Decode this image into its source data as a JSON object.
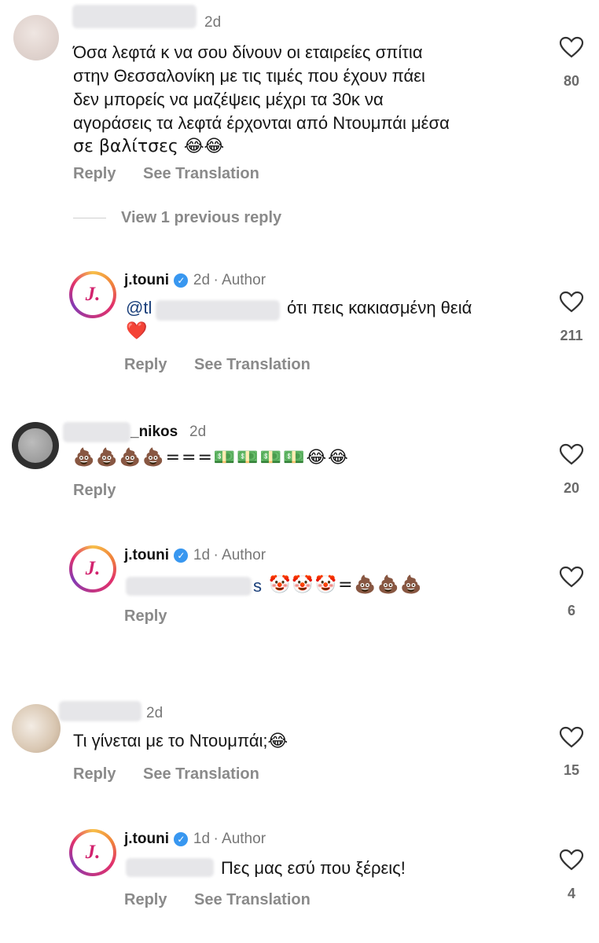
{
  "comments": [
    {
      "time": "2d",
      "text_lines": [
        "Όσα λεφτά κ να σου δίνουν οι εταιρείες σπίτια",
        "στην Θεσσαλονίκη με τις τιμές που έχουν πάει",
        "δεν μπορείς να μαζέψεις μέχρι τα 30κ να",
        "αγοράσεις τα λεφτά έρχονται από Ντουμπάι μέσα",
        "σε βαλίτσες 😂😂"
      ],
      "likes": "80",
      "reply": "Reply",
      "translate": "See Translation"
    },
    {
      "view_replies": "View 1 previous reply"
    },
    {
      "user": "j.touni",
      "time": "2d",
      "author": "· Author",
      "mention_prefix": "@tl",
      "text": "ότι πεις κακιασμένη θειά",
      "text2": "❤️",
      "likes": "211",
      "reply": "Reply",
      "translate": "See Translation"
    },
    {
      "user_suffix": "_nikos",
      "time": "2d",
      "text": "💩💩💩💩===💵💵💵💵😂😂",
      "likes": "20",
      "reply": "Reply"
    },
    {
      "user": "j.touni",
      "time": "1d",
      "author": "· Author",
      "mention_suffix": "s",
      "text": "🤡🤡🤡=💩💩💩",
      "likes": "6",
      "reply": "Reply"
    },
    {
      "time": "2d",
      "text": "Τι γίνεται με το Ντουμπάι;😂",
      "likes": "15",
      "reply": "Reply",
      "translate": "See Translation"
    },
    {
      "user": "j.touni",
      "time": "1d",
      "author": "· Author",
      "text": "Πες μας εσύ που ξέρεις!",
      "likes": "4",
      "reply": "Reply",
      "translate": "See Translation"
    }
  ],
  "brand_logo_letter": "J.",
  "icons": {
    "like": "heart-icon",
    "verified": "verified-badge-icon"
  }
}
